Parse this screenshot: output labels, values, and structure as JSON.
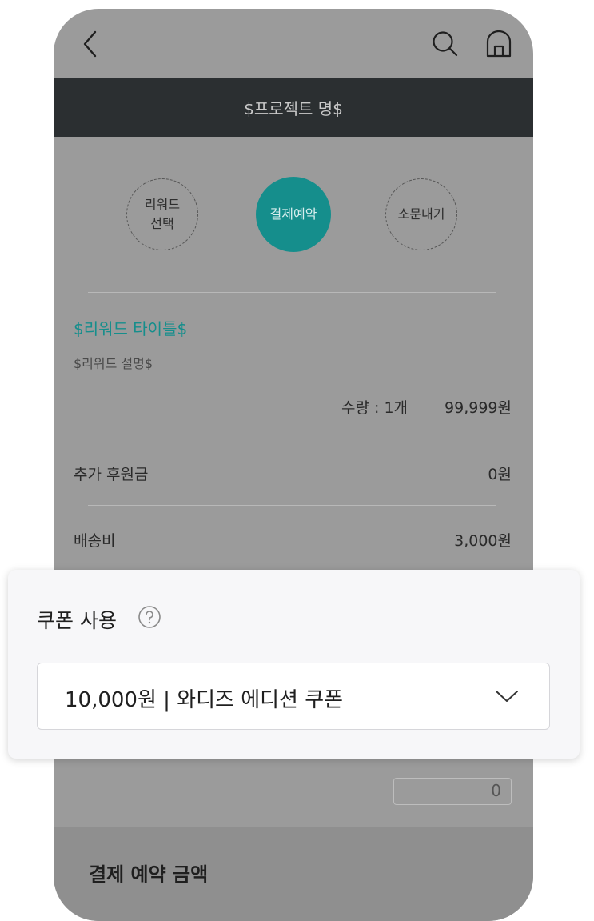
{
  "header": {
    "back_icon": "chevron-left-icon",
    "search_icon": "search-icon",
    "home_icon": "home-icon",
    "project_title": "$프로젝트 명$"
  },
  "steps": [
    {
      "label": "리워드\n선택",
      "state": "inactive"
    },
    {
      "label": "결제예약",
      "state": "active"
    },
    {
      "label": "소문내기",
      "state": "inactive"
    }
  ],
  "reward": {
    "title": "$리워드 타이틀$",
    "description": "$리워드 설명$",
    "quantity": "수량 : 1개",
    "price": "99,999원"
  },
  "extra_donation": {
    "label": "추가 후원금",
    "value": "0원"
  },
  "shipping": {
    "label": "배송비",
    "value": "3,000원"
  },
  "coupon": {
    "label": "쿠폰 사용",
    "help_icon": "question-circle-icon",
    "selected": "10,000원 | 와디즈 에디션 쿠폰",
    "dropdown_icon": "chevron-down-icon"
  },
  "point_input": {
    "value": "0"
  },
  "summary": {
    "title": "결제 예약 금액"
  },
  "colors": {
    "accent": "#158e8c",
    "overlay_bg": "#9b9b9b",
    "header_bg": "#2b2f31",
    "panel_bg": "#f7f7f9"
  }
}
